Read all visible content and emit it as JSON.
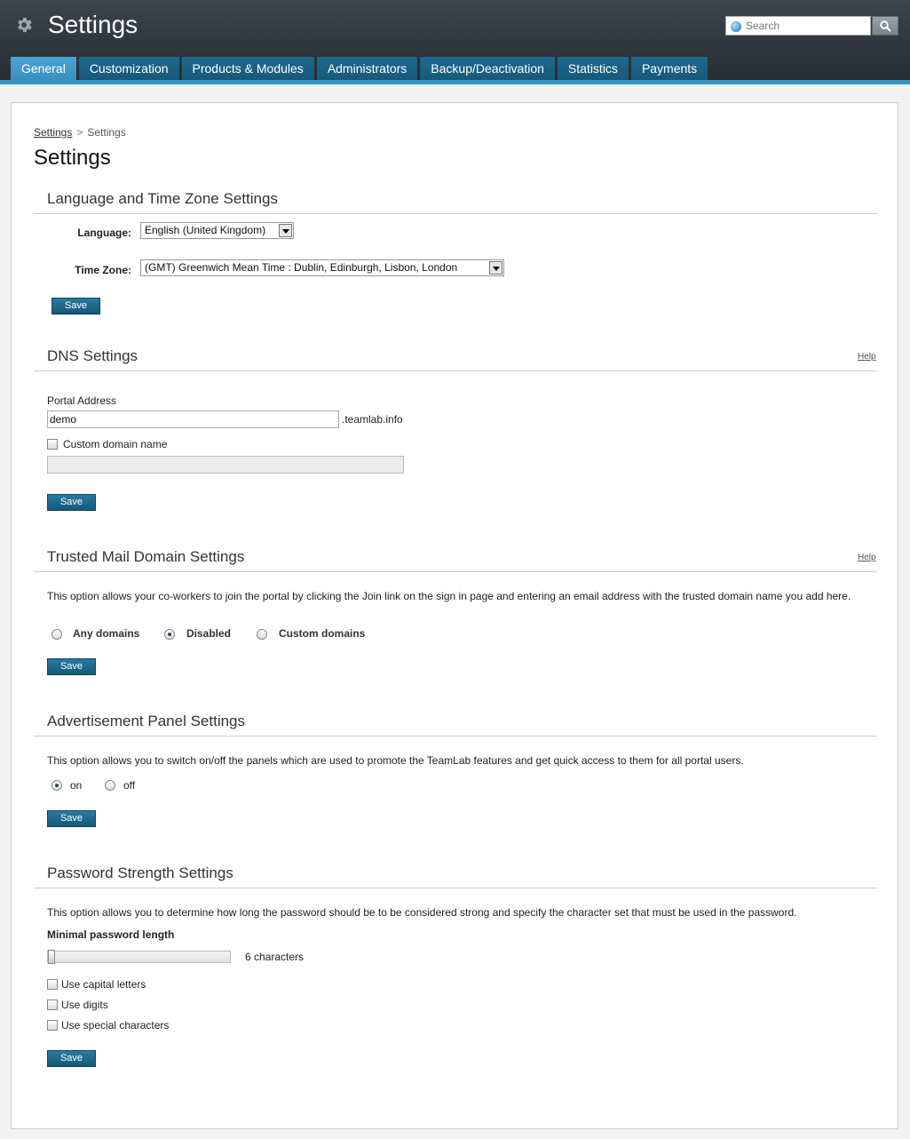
{
  "header": {
    "title": "Settings",
    "app_icon": "gear-icon",
    "search": {
      "placeholder": "Search",
      "icon": "globe-icon",
      "button_icon": "magnifier-icon"
    }
  },
  "tabs": [
    {
      "label": "General",
      "active": true
    },
    {
      "label": "Customization",
      "active": false
    },
    {
      "label": "Products & Modules",
      "active": false
    },
    {
      "label": "Administrators",
      "active": false
    },
    {
      "label": "Backup/Deactivation",
      "active": false
    },
    {
      "label": "Statistics",
      "active": false
    },
    {
      "label": "Payments",
      "active": false
    }
  ],
  "breadcrumb": {
    "link": "Settings",
    "separator": ">",
    "current": "Settings"
  },
  "page_title": "Settings",
  "language_section": {
    "title": "Language and Time Zone Settings",
    "language_label": "Language:",
    "language_value": "English (United Kingdom)",
    "timezone_label": "Time Zone:",
    "timezone_value": "(GMT) Greenwich Mean Time : Dublin, Edinburgh, Lisbon, London",
    "save": "Save"
  },
  "dns_section": {
    "title": "DNS Settings",
    "help": "Help",
    "portal_label": "Portal Address",
    "portal_value": "demo",
    "portal_suffix": ".teamlab.info",
    "custom_domain_label": "Custom domain name",
    "custom_domain_checked": false,
    "custom_domain_value": "",
    "save": "Save"
  },
  "trusted_section": {
    "title": "Trusted Mail Domain Settings",
    "help": "Help",
    "description": "This option allows your co-workers to join the portal by clicking the Join link on the sign in page and entering an email address with the trusted domain name you add here.",
    "options": [
      "Any domains",
      "Disabled",
      "Custom domains"
    ],
    "selected": "Disabled",
    "save": "Save"
  },
  "ad_section": {
    "title": "Advertisement Panel Settings",
    "description": "This option allows you to switch on/off the panels which are used to promote the TeamLab features and get quick access to them for all portal users.",
    "options": [
      "on",
      "off"
    ],
    "selected": "on",
    "save": "Save"
  },
  "password_section": {
    "title": "Password Strength Settings",
    "description": "This option allows you to determine how long the password should be to be considered strong and specify the character set that must be used in the password.",
    "min_length_label": "Minimal password length",
    "min_length_value": 6,
    "min_length_text": "6 characters",
    "slider_fraction": 0.0,
    "checkboxes": [
      {
        "label": "Use capital letters",
        "checked": false
      },
      {
        "label": "Use digits",
        "checked": false
      },
      {
        "label": "Use special characters",
        "checked": false
      }
    ],
    "save": "Save"
  }
}
